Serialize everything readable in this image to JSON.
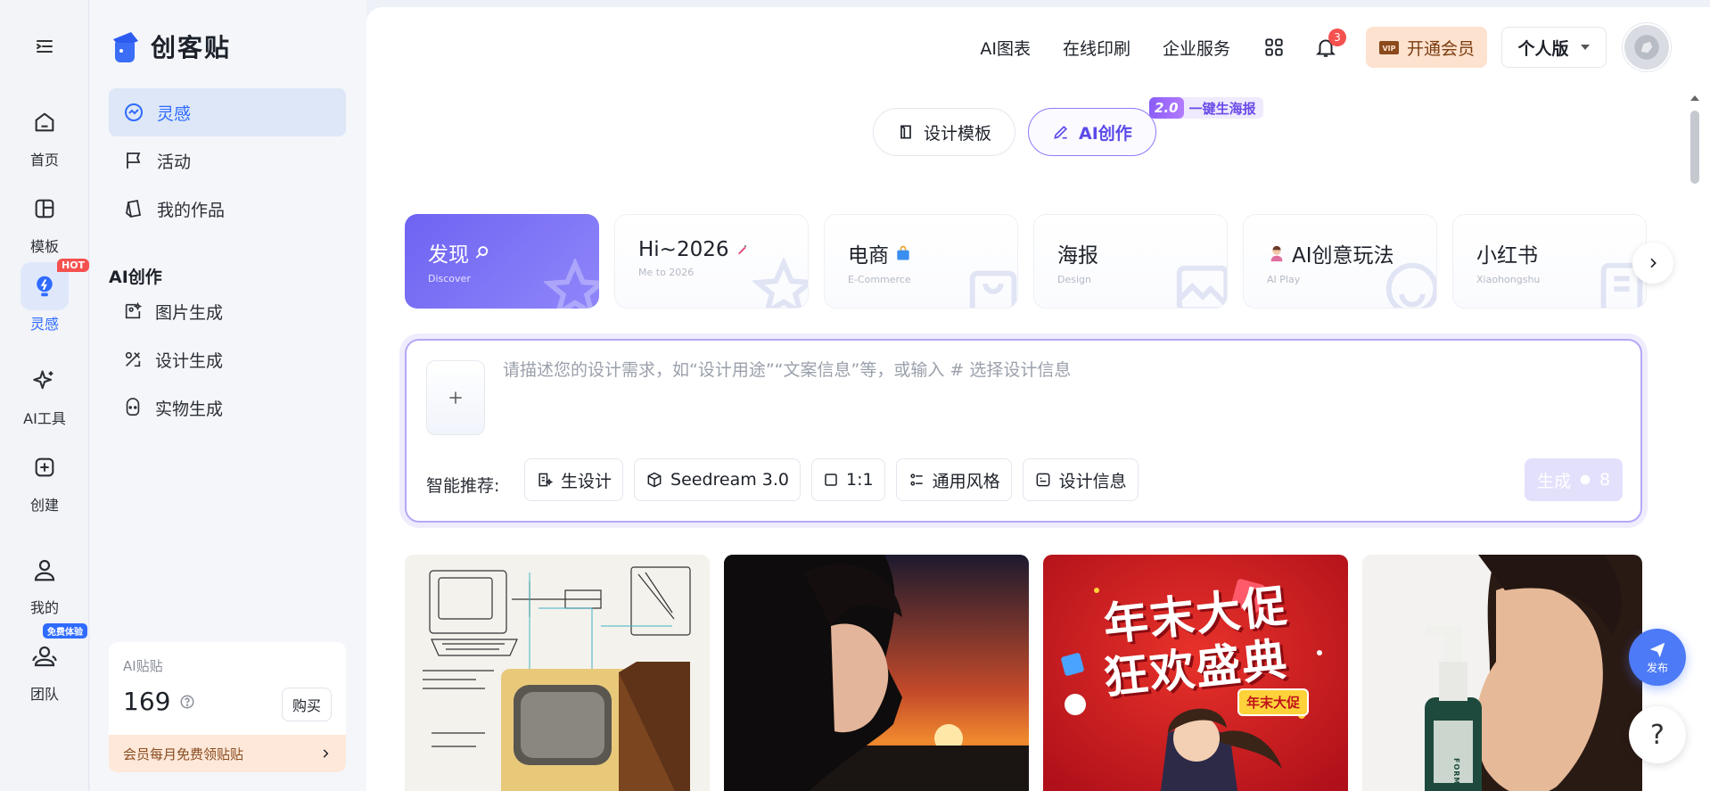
{
  "rail": {
    "items": [
      {
        "label": "首页"
      },
      {
        "label": "模板"
      },
      {
        "label": "灵感",
        "badge": "HOT"
      },
      {
        "label": "AI工具"
      },
      {
        "label": "创建"
      },
      {
        "label": "我的"
      },
      {
        "label": "团队",
        "badge": "免费体验"
      }
    ]
  },
  "sidebar": {
    "logo": "创客贴",
    "nav": [
      {
        "label": "灵感"
      },
      {
        "label": "活动"
      },
      {
        "label": "我的作品"
      }
    ],
    "section_title": "AI创作",
    "ai_nav": [
      {
        "label": "图片生成"
      },
      {
        "label": "设计生成"
      },
      {
        "label": "实物生成"
      }
    ],
    "points": {
      "label": "AI贴贴",
      "value": "169",
      "buy": "购买",
      "promo": "会员每月免费领贴贴"
    }
  },
  "topnav": {
    "links": [
      "AI图表",
      "在线印刷",
      "企业服务"
    ],
    "bell_count": "3",
    "vip": "开通会员",
    "version": "个人版"
  },
  "modes": {
    "tabs": [
      "设计模板",
      "AI创作"
    ],
    "badge_version": "2.0",
    "badge_text": "一键生海报"
  },
  "categories": [
    {
      "title": "发现",
      "sub": "Discover"
    },
    {
      "title": "Hi~2026",
      "sub": "Me to 2026"
    },
    {
      "title": "电商",
      "sub": "E-Commerce"
    },
    {
      "title": "海报",
      "sub": "Design"
    },
    {
      "title": "AI创意玩法",
      "sub": "AI Play"
    },
    {
      "title": "小红书",
      "sub": "Xiaohongshu"
    }
  ],
  "prompt": {
    "placeholder": "请描述您的设计需求，如“设计用途”“文案信息”等，或输入 # 选择设计信息",
    "rec_label": "智能推荐:",
    "chips": [
      "生设计",
      "Seedream 3.0",
      "1:1",
      "通用风格",
      "设计信息"
    ],
    "generate": "生成",
    "cost": "8"
  },
  "gallery": {
    "poster_line1": "年末大促",
    "poster_line2": "狂欢盛典",
    "poster_tag": "年末大促",
    "bottle_text": "FORMULA"
  },
  "floats": {
    "publish": "发布",
    "help": "?"
  },
  "colors": {
    "accent": "#2f6bff",
    "purple": "#6e63f2",
    "vip_bg": "#fde2cf"
  }
}
